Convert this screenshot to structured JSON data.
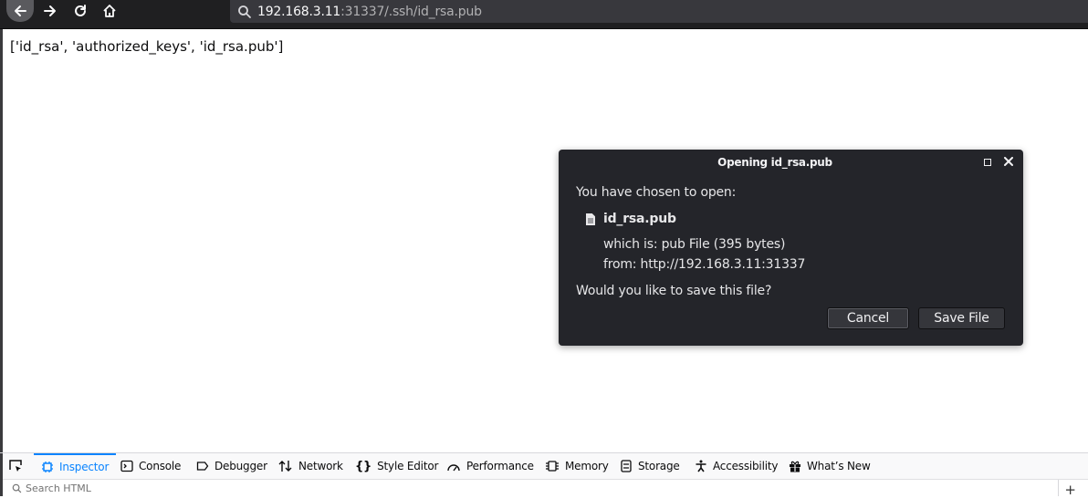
{
  "browser": {
    "url_host": "192.168.3.11",
    "url_rest": ":31337/.ssh/id_rsa.pub"
  },
  "page": {
    "body_text": "['id_rsa', 'authorized_keys', 'id_rsa.pub']"
  },
  "dialog": {
    "title": "Opening id_rsa.pub",
    "chosen_text": "You have chosen to open:",
    "file_name": "id_rsa.pub",
    "which_is": "which is:  pub File (395 bytes)",
    "from": "from:  http://192.168.3.11:31337",
    "question": "Would you like to save this file?",
    "cancel_label": "Cancel",
    "save_label": "Save File"
  },
  "devtools": {
    "tabs": [
      {
        "label": "Inspector",
        "icon": "inspector-icon",
        "selected": true
      },
      {
        "label": "Console",
        "icon": "console-icon"
      },
      {
        "label": "Debugger",
        "icon": "debugger-icon"
      },
      {
        "label": "Network",
        "icon": "network-icon"
      },
      {
        "label": "Style Editor",
        "icon": "style-editor-icon"
      },
      {
        "label": "Performance",
        "icon": "performance-icon"
      },
      {
        "label": "Memory",
        "icon": "memory-icon"
      },
      {
        "label": "Storage",
        "icon": "storage-icon"
      },
      {
        "label": "Accessibility",
        "icon": "accessibility-icon"
      },
      {
        "label": "What’s New",
        "icon": "whats-new-icon"
      }
    ],
    "search_placeholder": "Search HTML",
    "accent_color": "#0a84ff"
  }
}
